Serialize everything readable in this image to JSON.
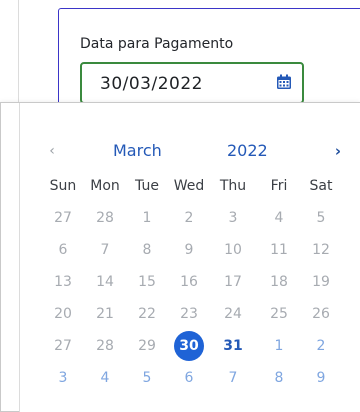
{
  "field": {
    "label": "Data para Pagamento",
    "value": "30/03/2022",
    "icon": "calendar-icon"
  },
  "calendar": {
    "prev_symbol": "‹",
    "next_symbol": "›",
    "month": "March",
    "year": "2022",
    "weekdays": [
      "Sun",
      "Mon",
      "Tue",
      "Wed",
      "Thu",
      "Fri",
      "Sat"
    ],
    "weeks": [
      [
        "27",
        "28",
        "1",
        "2",
        "3",
        "4",
        "5"
      ],
      [
        "6",
        "7",
        "8",
        "9",
        "10",
        "11",
        "12"
      ],
      [
        "13",
        "14",
        "15",
        "16",
        "17",
        "18",
        "19"
      ],
      [
        "20",
        "21",
        "22",
        "23",
        "24",
        "25",
        "26"
      ],
      [
        "27",
        "28",
        "29",
        "30",
        "31",
        "1",
        "2"
      ],
      [
        "3",
        "4",
        "5",
        "6",
        "7",
        "8",
        "9"
      ]
    ],
    "selected": "30",
    "highlighted": "31",
    "next_month_days": [
      "1",
      "2",
      "3",
      "4",
      "5",
      "6",
      "7",
      "8",
      "9"
    ],
    "colors": {
      "accent": "#1f63d6",
      "header": "#2459b7",
      "muted": "#a7abb1",
      "next_month": "#7fa6e0",
      "input_border": "#3a8a3e",
      "card_border": "#3b35c8"
    }
  }
}
